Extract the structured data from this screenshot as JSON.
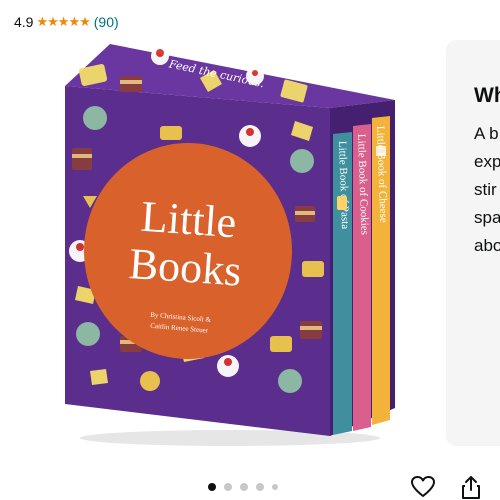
{
  "rating": {
    "value": "4.9",
    "stars": 5,
    "count": "(90)"
  },
  "product": {
    "box_title_line1": "Little",
    "box_title_line2": "Books",
    "tagline": "Feed the curious.",
    "authors_line1": "By Christina Sicoli &",
    "authors_line2": "Caitlin Renee Steuer",
    "spines": [
      {
        "title": "Little Book of Pasta",
        "color": "#3f8f9e"
      },
      {
        "title": "Little Book of Cookies",
        "color": "#d95f8c"
      },
      {
        "title": "Little Book of Cheese",
        "color": "#f3b33a"
      }
    ],
    "colors": {
      "box": "#5b2d8c",
      "box_side": "#452070",
      "circle": "#d9612b"
    }
  },
  "side_card": {
    "title": "Wh",
    "lines": [
      "A b",
      "exp",
      "stir",
      "spa",
      "abo"
    ]
  },
  "carousel": {
    "total": 5,
    "active": 0
  },
  "actions": {
    "favorite_icon": "heart-icon",
    "share_icon": "share-icon"
  }
}
